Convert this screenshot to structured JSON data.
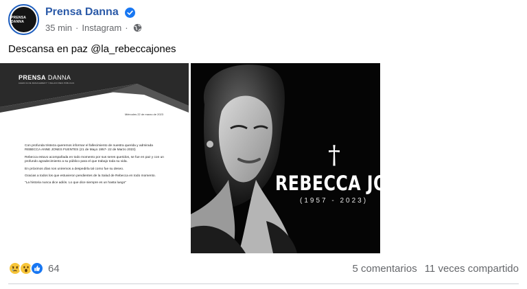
{
  "post": {
    "page_name": "Prensa Danna",
    "avatar_text": "PRENSA DANNA",
    "time": "35 min",
    "separator": "·",
    "source": "Instagram",
    "caption": "Descansa en paz @la_rebeccajones"
  },
  "document": {
    "logo_bold": "PRENSA",
    "logo_light": "DANNA",
    "tagline": "AGENCIA DE MANAGEMENT Y RELACIONES PÚBLICAS",
    "date": "Miércoles 22 de marzo de 2023",
    "paragraphs": [
      "Con profunda tristeza queremos informar el fallecimiento de nuestra querida y admirada REBECCA ANNE JONES FUENTES (21 de Mayo 1957- 22 de Marzo 2023)",
      "Rebecca estuvo acompañada en todo momento por sus seres queridos, se fue en paz y con un profundo agradecimiento a su público para el que trabajo toda su vida.",
      "En próximos días nos uniremos a despedirla tal como fue su deseo.",
      "Gracias a todos los que estuvieron pendientes de la Salud de Rebecca en todo momento.",
      "\"La historia nunca dice adiós. Lo que dice siempre es un hasta luego\""
    ]
  },
  "memorial": {
    "cross": "†",
    "name": "REBECCA JONE",
    "years": "(1957 - 2023)"
  },
  "footer": {
    "reaction_count": "64",
    "reactions": [
      "sad-icon",
      "wow-icon",
      "like-icon"
    ],
    "comments": "5 comentarios",
    "shares": "11 veces compartido"
  },
  "colors": {
    "brand_blue": "#2b5aa8",
    "verified_blue": "#1877f2",
    "secondary_text": "#65676b"
  }
}
